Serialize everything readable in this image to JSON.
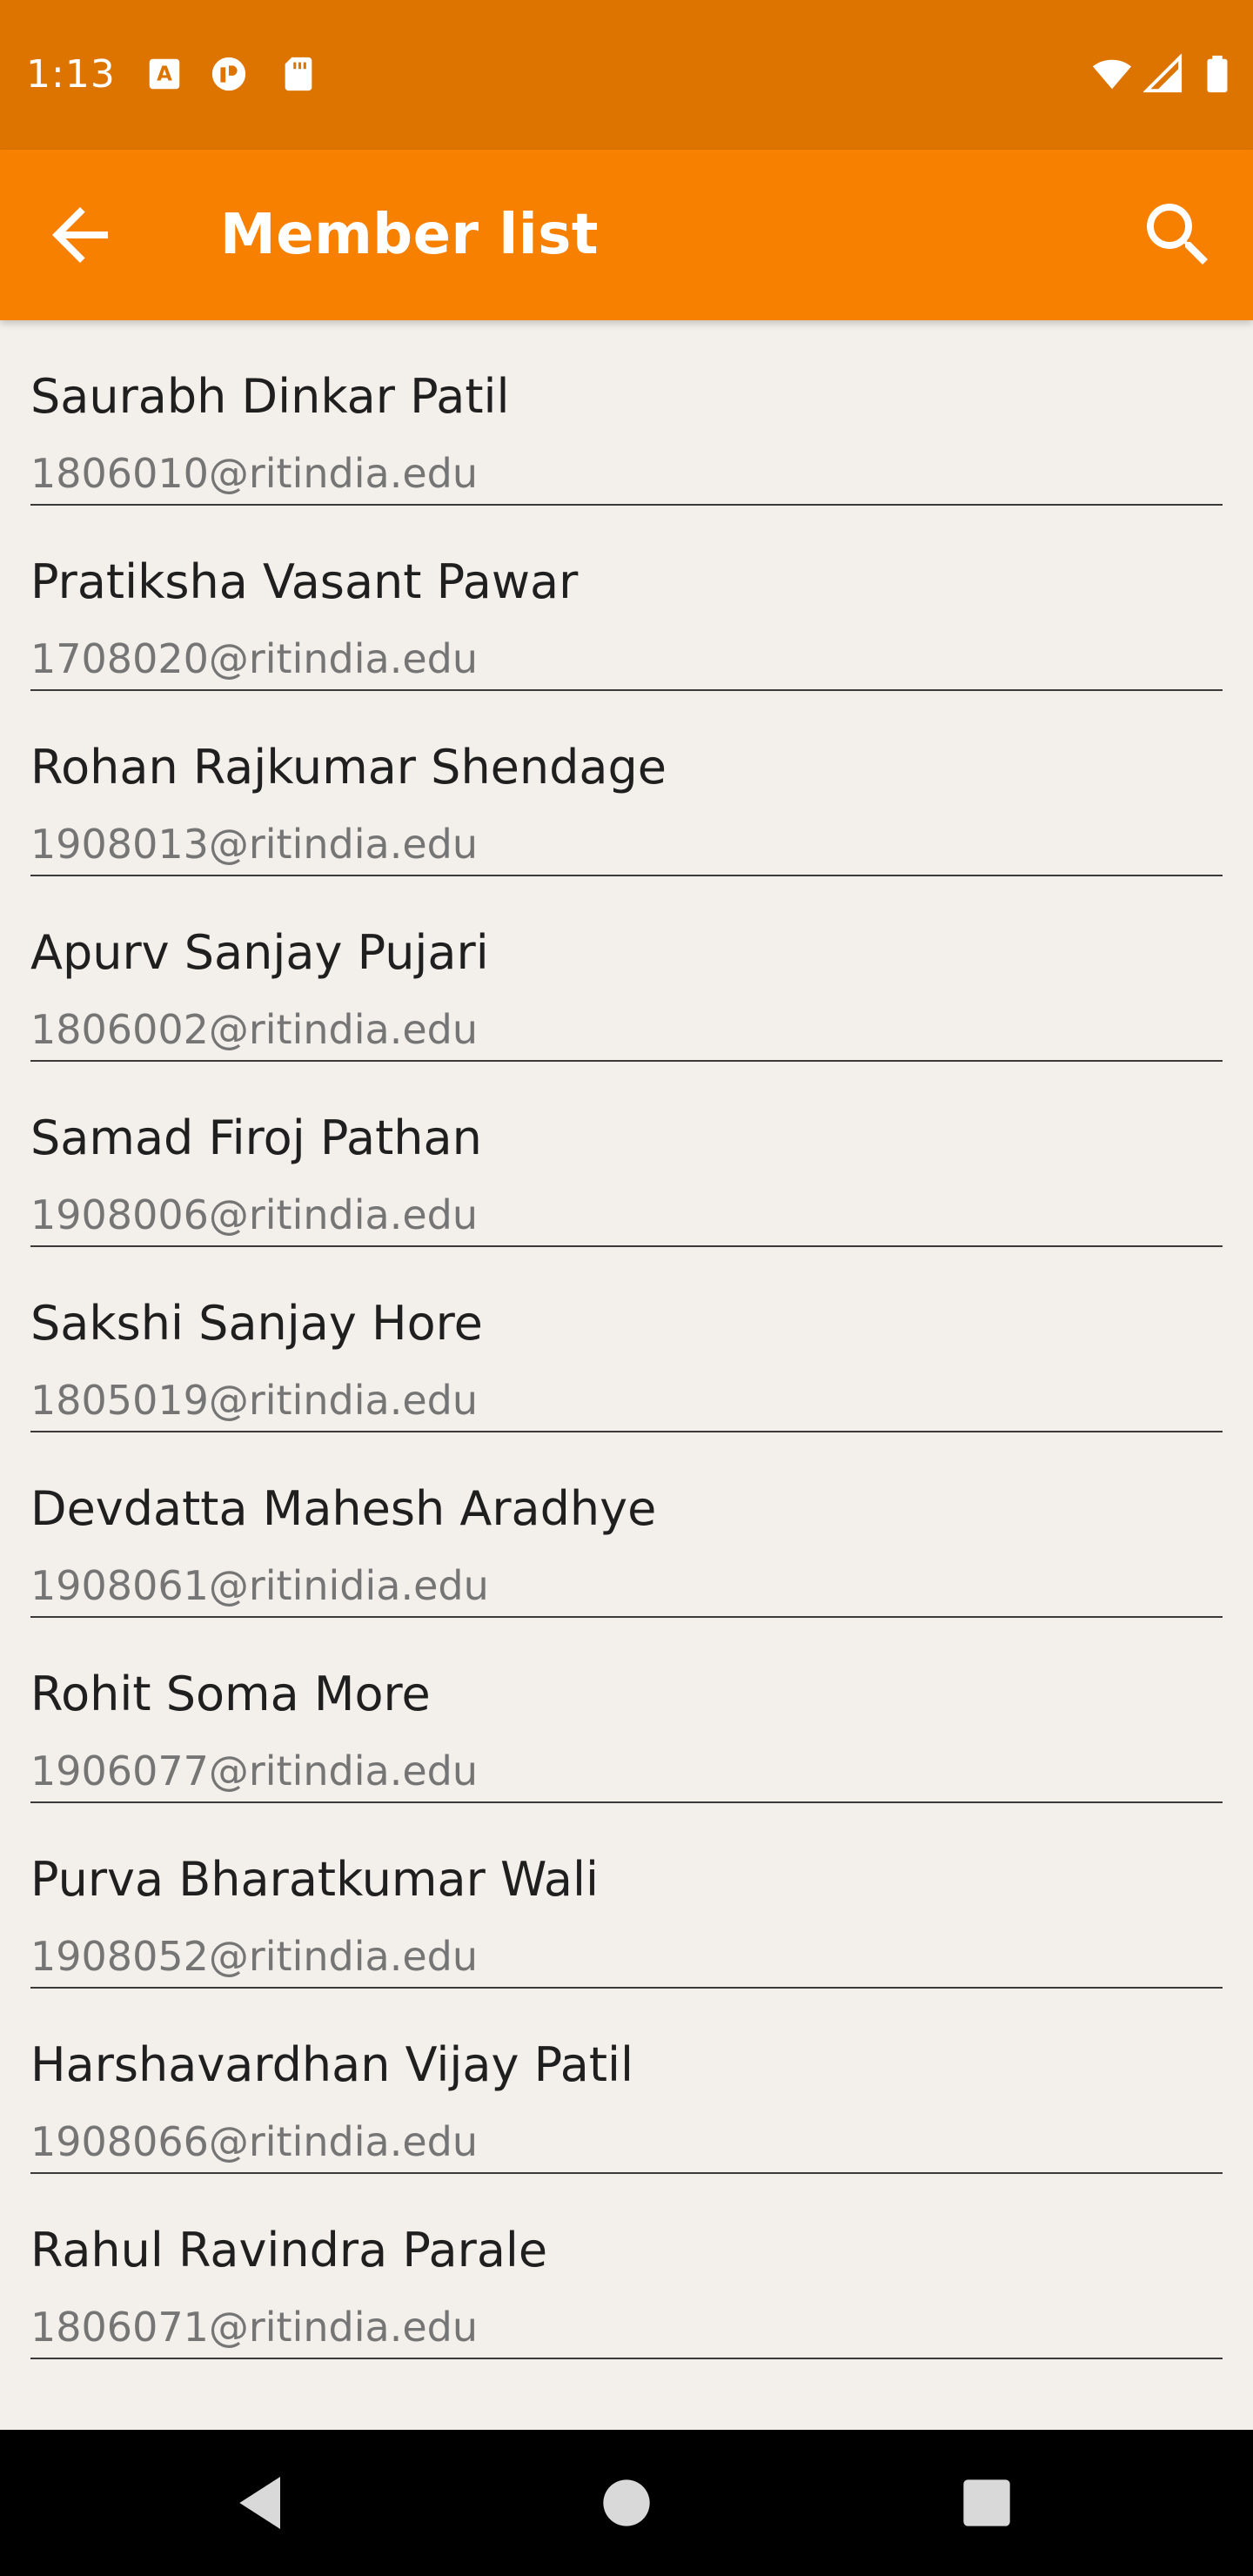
{
  "status_bar": {
    "time": "1:13",
    "icons": [
      "text-a-icon",
      "sim-card-alt-icon",
      "sd-card-icon",
      "wifi-icon",
      "cell-signal-icon",
      "battery-icon"
    ]
  },
  "app_bar": {
    "title": "Member list",
    "back_icon": "arrow-left-icon",
    "search_icon": "search-icon"
  },
  "members": [
    {
      "name": "Saurabh Dinkar Patil",
      "email": "1806010@ritindia.edu"
    },
    {
      "name": "Pratiksha Vasant Pawar",
      "email": "1708020@ritindia.edu"
    },
    {
      "name": "Rohan Rajkumar Shendage",
      "email": "1908013@ritindia.edu"
    },
    {
      "name": "Apurv Sanjay Pujari",
      "email": "1806002@ritindia.edu"
    },
    {
      "name": "Samad Firoj Pathan",
      "email": "1908006@ritindia.edu"
    },
    {
      "name": "Sakshi Sanjay Hore",
      "email": "1805019@ritindia.edu"
    },
    {
      "name": "Devdatta Mahesh Aradhye",
      "email": "1908061@ritinidia.edu"
    },
    {
      "name": "Rohit Soma More",
      "email": "1906077@ritindia.edu"
    },
    {
      "name": "Purva Bharatkumar Wali",
      "email": "1908052@ritindia.edu"
    },
    {
      "name": "Harshavardhan Vijay Patil",
      "email": "1908066@ritindia.edu"
    },
    {
      "name": "Rahul Ravindra Parale",
      "email": "1806071@ritindia.edu"
    },
    {
      "name": "",
      "email": ""
    }
  ],
  "nav_bar": {
    "icons": [
      "back-triangle-icon",
      "home-circle-icon",
      "recents-square-icon"
    ]
  },
  "colors": {
    "status_bar": "#de7400",
    "app_bar": "#f78000",
    "background": "#f3efea",
    "divider": "#3a3a3a",
    "name_text": "#1f1f1f",
    "email_text": "#757575"
  }
}
